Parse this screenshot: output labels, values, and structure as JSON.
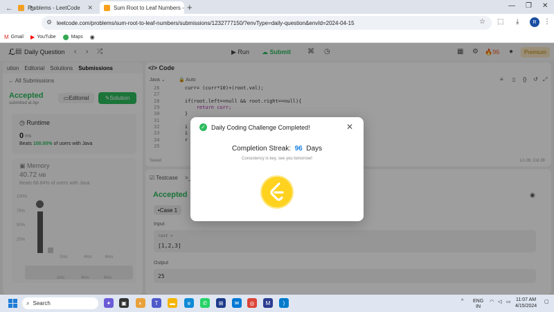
{
  "browser": {
    "tabs": [
      {
        "title": "Problems - LeetCode"
      },
      {
        "title": "Sum Root to Leaf Numbers - Le"
      }
    ],
    "url": "leetcode.com/problems/sum-root-to-leaf-numbers/submissions/1232777150/?envType=daily-question&envId=2024-04-15",
    "bookmarks": [
      "Gmail",
      "YouTube",
      "Maps"
    ],
    "profile_initial": "R"
  },
  "app": {
    "daily_question": "Daily Question",
    "run_label": "Run",
    "submit_label": "Submit",
    "streak_count": "96",
    "premium_label": "Premium",
    "left_tabs": [
      "ution",
      "Editorial",
      "Solutions",
      "Submissions"
    ],
    "all_submissions": "All Submissions",
    "status": "Accepted",
    "submitted_at": "submitted at Apr",
    "editorial_btn": "Editorial",
    "solution_btn": "Solution",
    "runtime_label": "Runtime",
    "runtime_value": "0",
    "runtime_unit": "ms",
    "runtime_beats_prefix": "Beats",
    "runtime_beats_pct": "100.00%",
    "runtime_beats_suffix": "of users with Java",
    "memory_label": "Memory",
    "memory_value": "40.72",
    "memory_unit": "MB",
    "memory_beats": "Beats 68.84% of users with Java",
    "y_ticks": [
      "100%",
      "75%",
      "50%",
      "25%"
    ],
    "x_ticks": [
      "2ms",
      "4ms",
      "6ms"
    ],
    "mini_ticks": [
      "2ms",
      "4ms",
      "6ms"
    ],
    "code_tab": "Code",
    "language": "Java",
    "auto": "Auto",
    "saved": "Saved",
    "cursor_pos": "Ln 28, Col 28",
    "code_lines": [
      {
        "n": "26",
        "text": "    curr= (curr*10)+(root.val);"
      },
      {
        "n": "27",
        "text": ""
      },
      {
        "n": "28",
        "text": "    if(root.left==null && root.right==null){"
      },
      {
        "n": "29",
        "text": "        return curr;"
      },
      {
        "n": "30",
        "text": "    }"
      },
      {
        "n": "31",
        "text": ""
      },
      {
        "n": "32",
        "text": "    i"
      },
      {
        "n": "33",
        "text": "    i"
      },
      {
        "n": "34",
        "text": "    r"
      },
      {
        "n": "35",
        "text": ""
      }
    ],
    "testcase_tab": "Testcase",
    "test_status": "Accepted",
    "case_label": "Case 1",
    "input_label": "Input",
    "input_var": "root =",
    "input_value": "[1,2,3]",
    "output_label": "Output",
    "output_value": "25"
  },
  "modal": {
    "title": "Daily Coding Challenge Completed!",
    "streak_prefix": "Completion Streak:",
    "streak_number": "96",
    "streak_suffix": "Days",
    "subtitle": "Consistency is key, see you tomorrow!"
  },
  "taskbar": {
    "search_placeholder": "Search",
    "lang_top": "ENG",
    "lang_bottom": "IN",
    "time": "11:07 AM",
    "date": "4/15/2024"
  },
  "colors": {
    "accent_green": "#2cbb5d",
    "streak_blue": "#1a82e2",
    "badge_yellow": "#ffd21f"
  }
}
